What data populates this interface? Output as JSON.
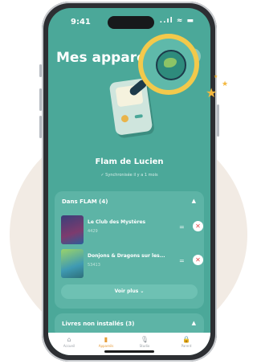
{
  "status_bar": {
    "time": "9:41",
    "icons": "..ıl ≈ ▬"
  },
  "header": {
    "title": "Mes appareils",
    "add_icon": "+"
  },
  "device": {
    "name": "Flam de Lucien",
    "sync_text": "✓ Synchronisée il y a 1 mois"
  },
  "section_installed": {
    "title": "Dans FLAM (4)",
    "collapse_icon": "▲",
    "books": [
      {
        "title": "Le Club des Mystères",
        "code": "4429",
        "drag_icon": "=",
        "remove_icon": "✕"
      },
      {
        "title": "Donjons & Dragons sur les...",
        "code": "53413",
        "drag_icon": "=",
        "remove_icon": "✕"
      }
    ],
    "see_more": "Voir plus ⌄"
  },
  "section_not_installed": {
    "title": "Livres non installés (3)",
    "collapse_icon": "▲"
  },
  "tabbar": {
    "tabs": [
      {
        "label": "Accueil",
        "icon": "⌂"
      },
      {
        "label": "Appareils",
        "icon": "▮"
      },
      {
        "label": "Studio",
        "icon": "🎙"
      },
      {
        "label": "Parent",
        "icon": "🔒"
      }
    ]
  },
  "colors": {
    "screen": "#4ba899",
    "accent": "#f3b73d",
    "remove": "#e04b4b",
    "active_tab": "#e69c38"
  }
}
